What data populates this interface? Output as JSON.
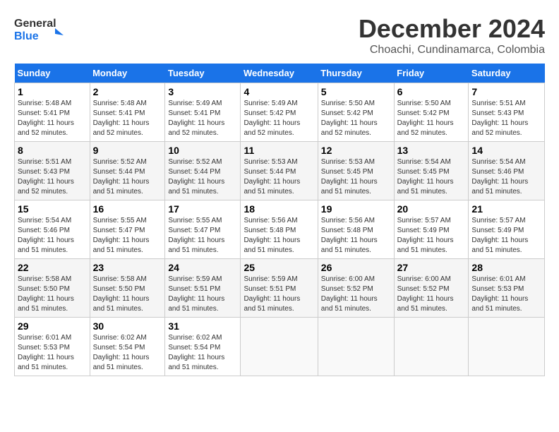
{
  "header": {
    "logo_line1": "General",
    "logo_line2": "Blue",
    "title": "December 2024",
    "subtitle": "Choachi, Cundinamarca, Colombia"
  },
  "calendar": {
    "weekdays": [
      "Sunday",
      "Monday",
      "Tuesday",
      "Wednesday",
      "Thursday",
      "Friday",
      "Saturday"
    ],
    "weeks": [
      [
        {
          "day": "1",
          "info": "Sunrise: 5:48 AM\nSunset: 5:41 PM\nDaylight: 11 hours\nand 52 minutes."
        },
        {
          "day": "2",
          "info": "Sunrise: 5:48 AM\nSunset: 5:41 PM\nDaylight: 11 hours\nand 52 minutes."
        },
        {
          "day": "3",
          "info": "Sunrise: 5:49 AM\nSunset: 5:41 PM\nDaylight: 11 hours\nand 52 minutes."
        },
        {
          "day": "4",
          "info": "Sunrise: 5:49 AM\nSunset: 5:42 PM\nDaylight: 11 hours\nand 52 minutes."
        },
        {
          "day": "5",
          "info": "Sunrise: 5:50 AM\nSunset: 5:42 PM\nDaylight: 11 hours\nand 52 minutes."
        },
        {
          "day": "6",
          "info": "Sunrise: 5:50 AM\nSunset: 5:42 PM\nDaylight: 11 hours\nand 52 minutes."
        },
        {
          "day": "7",
          "info": "Sunrise: 5:51 AM\nSunset: 5:43 PM\nDaylight: 11 hours\nand 52 minutes."
        }
      ],
      [
        {
          "day": "8",
          "info": "Sunrise: 5:51 AM\nSunset: 5:43 PM\nDaylight: 11 hours\nand 52 minutes."
        },
        {
          "day": "9",
          "info": "Sunrise: 5:52 AM\nSunset: 5:44 PM\nDaylight: 11 hours\nand 51 minutes."
        },
        {
          "day": "10",
          "info": "Sunrise: 5:52 AM\nSunset: 5:44 PM\nDaylight: 11 hours\nand 51 minutes."
        },
        {
          "day": "11",
          "info": "Sunrise: 5:53 AM\nSunset: 5:44 PM\nDaylight: 11 hours\nand 51 minutes."
        },
        {
          "day": "12",
          "info": "Sunrise: 5:53 AM\nSunset: 5:45 PM\nDaylight: 11 hours\nand 51 minutes."
        },
        {
          "day": "13",
          "info": "Sunrise: 5:54 AM\nSunset: 5:45 PM\nDaylight: 11 hours\nand 51 minutes."
        },
        {
          "day": "14",
          "info": "Sunrise: 5:54 AM\nSunset: 5:46 PM\nDaylight: 11 hours\nand 51 minutes."
        }
      ],
      [
        {
          "day": "15",
          "info": "Sunrise: 5:54 AM\nSunset: 5:46 PM\nDaylight: 11 hours\nand 51 minutes."
        },
        {
          "day": "16",
          "info": "Sunrise: 5:55 AM\nSunset: 5:47 PM\nDaylight: 11 hours\nand 51 minutes."
        },
        {
          "day": "17",
          "info": "Sunrise: 5:55 AM\nSunset: 5:47 PM\nDaylight: 11 hours\nand 51 minutes."
        },
        {
          "day": "18",
          "info": "Sunrise: 5:56 AM\nSunset: 5:48 PM\nDaylight: 11 hours\nand 51 minutes."
        },
        {
          "day": "19",
          "info": "Sunrise: 5:56 AM\nSunset: 5:48 PM\nDaylight: 11 hours\nand 51 minutes."
        },
        {
          "day": "20",
          "info": "Sunrise: 5:57 AM\nSunset: 5:49 PM\nDaylight: 11 hours\nand 51 minutes."
        },
        {
          "day": "21",
          "info": "Sunrise: 5:57 AM\nSunset: 5:49 PM\nDaylight: 11 hours\nand 51 minutes."
        }
      ],
      [
        {
          "day": "22",
          "info": "Sunrise: 5:58 AM\nSunset: 5:50 PM\nDaylight: 11 hours\nand 51 minutes."
        },
        {
          "day": "23",
          "info": "Sunrise: 5:58 AM\nSunset: 5:50 PM\nDaylight: 11 hours\nand 51 minutes."
        },
        {
          "day": "24",
          "info": "Sunrise: 5:59 AM\nSunset: 5:51 PM\nDaylight: 11 hours\nand 51 minutes."
        },
        {
          "day": "25",
          "info": "Sunrise: 5:59 AM\nSunset: 5:51 PM\nDaylight: 11 hours\nand 51 minutes."
        },
        {
          "day": "26",
          "info": "Sunrise: 6:00 AM\nSunset: 5:52 PM\nDaylight: 11 hours\nand 51 minutes."
        },
        {
          "day": "27",
          "info": "Sunrise: 6:00 AM\nSunset: 5:52 PM\nDaylight: 11 hours\nand 51 minutes."
        },
        {
          "day": "28",
          "info": "Sunrise: 6:01 AM\nSunset: 5:53 PM\nDaylight: 11 hours\nand 51 minutes."
        }
      ],
      [
        {
          "day": "29",
          "info": "Sunrise: 6:01 AM\nSunset: 5:53 PM\nDaylight: 11 hours\nand 51 minutes."
        },
        {
          "day": "30",
          "info": "Sunrise: 6:02 AM\nSunset: 5:54 PM\nDaylight: 11 hours\nand 51 minutes."
        },
        {
          "day": "31",
          "info": "Sunrise: 6:02 AM\nSunset: 5:54 PM\nDaylight: 11 hours\nand 51 minutes."
        },
        null,
        null,
        null,
        null
      ]
    ]
  }
}
